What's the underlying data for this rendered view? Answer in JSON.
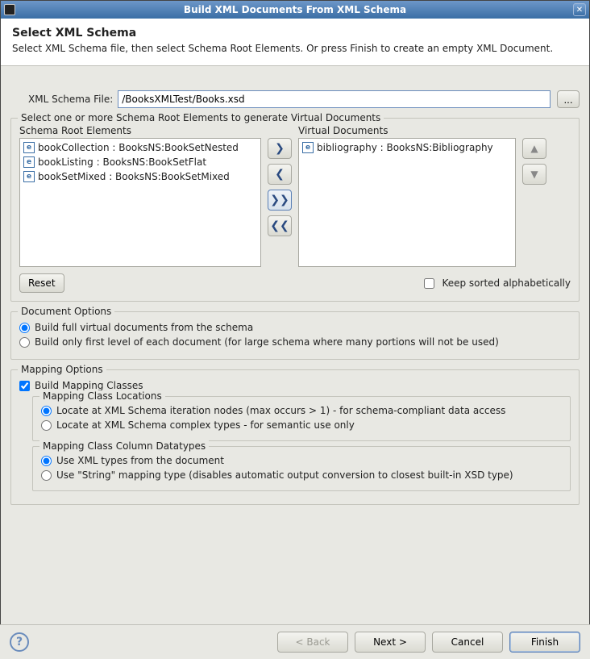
{
  "window": {
    "title": "Build XML Documents From XML Schema"
  },
  "header": {
    "heading": "Select XML Schema",
    "subheading": "Select XML Schema file, then select Schema Root Elements. Or press Finish to create an empty XML Document."
  },
  "schemaFile": {
    "label": "XML Schema File:",
    "value": "/BooksXMLTest/Books.xsd",
    "browse": "..."
  },
  "rootGroup": {
    "legend": "Select one or more Schema Root Elements to generate Virtual Documents",
    "leftLabel": "Schema Root Elements",
    "rightLabel": "Virtual Documents",
    "leftItems": [
      "bookCollection : BooksNS:BookSetNested",
      "bookListing : BooksNS:BookSetFlat",
      "bookSetMixed : BooksNS:BookSetMixed"
    ],
    "rightItems": [
      "bibliography : BooksNS:Bibliography"
    ],
    "reset": "Reset",
    "keepSorted": "Keep sorted alphabetically"
  },
  "documentOptions": {
    "legend": "Document Options",
    "opt1": "Build full virtual documents from the schema",
    "opt2": "Build only first level of each document (for large schema where many portions will not be used)"
  },
  "mappingOptions": {
    "legend": "Mapping Options",
    "buildClasses": "Build Mapping Classes",
    "locations": {
      "legend": "Mapping Class Locations",
      "opt1": "Locate at XML Schema iteration nodes (max occurs > 1) - for schema-compliant data access",
      "opt2": "Locate at XML Schema complex types - for semantic use only"
    },
    "datatypes": {
      "legend": "Mapping Class Column Datatypes",
      "opt1": "Use XML types from the document",
      "opt2": "Use \"String\" mapping type (disables automatic output conversion to closest built-in XSD type)"
    }
  },
  "footer": {
    "back": "< Back",
    "next": "Next >",
    "cancel": "Cancel",
    "finish": "Finish"
  }
}
